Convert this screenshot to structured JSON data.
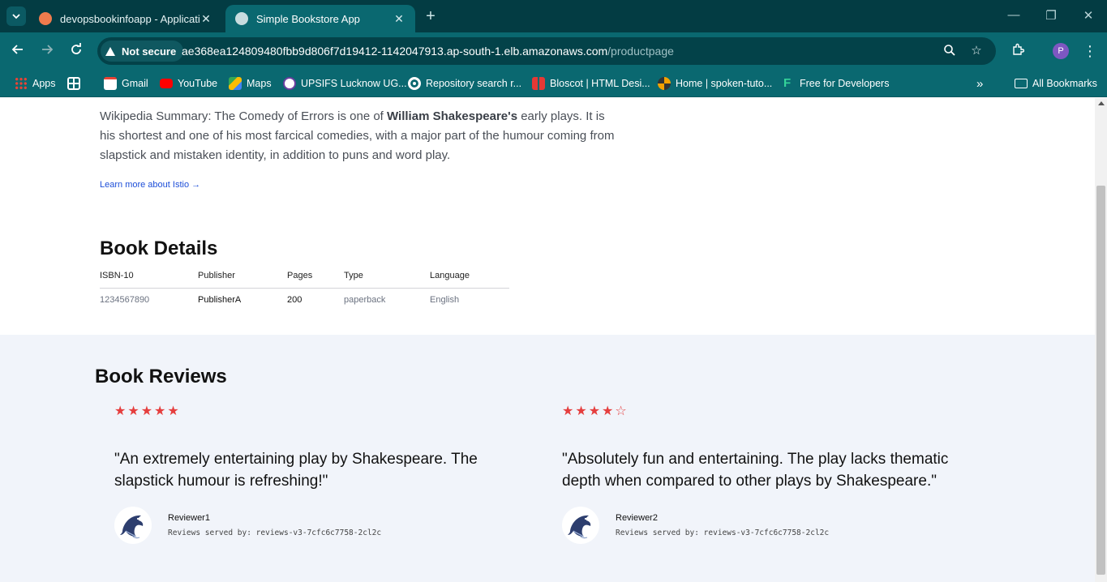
{
  "browser": {
    "tabs": [
      {
        "title": "devopsbookinfoapp - Applicati",
        "active": false
      },
      {
        "title": "Simple Bookstore App",
        "active": true
      }
    ],
    "security_label": "Not secure",
    "url_host": "ae368ea124809480fbb9d806f7d19412-1142047913.ap-south-1.elb.amazonaws.com",
    "url_path": "/productpage",
    "profile_initial": "P",
    "bookmarks": [
      {
        "label": "Apps",
        "icon": "apps-grid-icon"
      },
      {
        "label": "",
        "icon": "tab-groups-icon"
      },
      {
        "label": "Gmail",
        "icon": "gmail-icon"
      },
      {
        "label": "YouTube",
        "icon": "youtube-icon"
      },
      {
        "label": "Maps",
        "icon": "maps-icon"
      },
      {
        "label": "UPSIFS Lucknow UG...",
        "icon": "upsifs-icon"
      },
      {
        "label": "Repository search r...",
        "icon": "github-icon"
      },
      {
        "label": "Bloscot | HTML Desi...",
        "icon": "bloscot-icon"
      },
      {
        "label": "Home | spoken-tuto...",
        "icon": "spoken-tutorial-icon"
      },
      {
        "label": "Free for Developers",
        "icon": "free-dev-icon"
      }
    ],
    "all_bookmarks_label": "All Bookmarks"
  },
  "product": {
    "summary_prefix": "Wikipedia Summary: The Comedy of Errors is one of ",
    "summary_bold": "William Shakespeare's",
    "summary_suffix": " early plays. It is his shortest and one of his most farcical comedies, with a major part of the humour coming from slapstick and mistaken identity, in addition to puns and word play.",
    "learn_more": "Learn more about Istio →"
  },
  "details": {
    "title": "Book Details",
    "headers": [
      "ISBN-10",
      "Publisher",
      "Pages",
      "Type",
      "Language"
    ],
    "values": [
      "1234567890",
      "PublisherA",
      "200",
      "paperback",
      "English"
    ]
  },
  "reviews": {
    "title": "Book Reviews",
    "items": [
      {
        "stars": "★★★★★",
        "rating": 5,
        "text": "\"An extremely entertaining play by Shakespeare. The slapstick humour is refreshing!\"",
        "reviewer": "Reviewer1",
        "served_by": "Reviews served by: reviews-v3-7cfc6c7758-2cl2c"
      },
      {
        "stars": "★★★★☆",
        "rating": 4,
        "text": "\"Absolutely fun and entertaining. The play lacks thematic depth when compared to other plays by Shakespeare.\"",
        "reviewer": "Reviewer2",
        "served_by": "Reviews served by: reviews-v3-7cfc6c7758-2cl2c"
      }
    ]
  },
  "colors": {
    "chrome_dark": "#033c43",
    "chrome": "#0a6870",
    "star": "#e53e3e",
    "reviews_bg": "#f1f4fa",
    "link": "#1d4ed8"
  }
}
